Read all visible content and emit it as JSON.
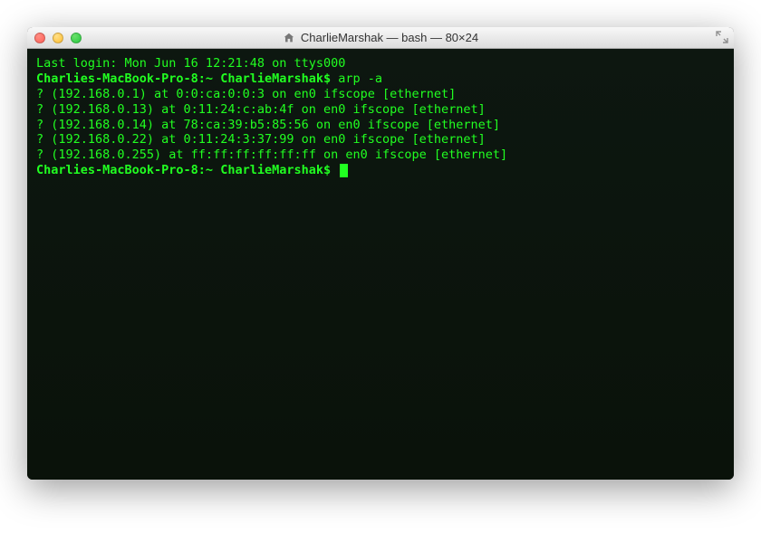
{
  "window": {
    "title": "CharlieMarshak — bash — 80×24"
  },
  "terminal": {
    "last_login": "Last login: Mon Jun 16 12:21:48 on ttys000",
    "prompt_host": "Charlies-MacBook-Pro-8:~ CharlieMarshak$",
    "command": "arp -a",
    "output": [
      "? (192.168.0.1) at 0:0:ca:0:0:3 on en0 ifscope [ethernet]",
      "? (192.168.0.13) at 0:11:24:c:ab:4f on en0 ifscope [ethernet]",
      "? (192.168.0.14) at 78:ca:39:b5:85:56 on en0 ifscope [ethernet]",
      "? (192.168.0.22) at 0:11:24:3:37:99 on en0 ifscope [ethernet]",
      "? (192.168.0.255) at ff:ff:ff:ff:ff:ff on en0 ifscope [ethernet]"
    ],
    "prompt2_host": "Charlies-MacBook-Pro-8:~ CharlieMarshak$"
  }
}
